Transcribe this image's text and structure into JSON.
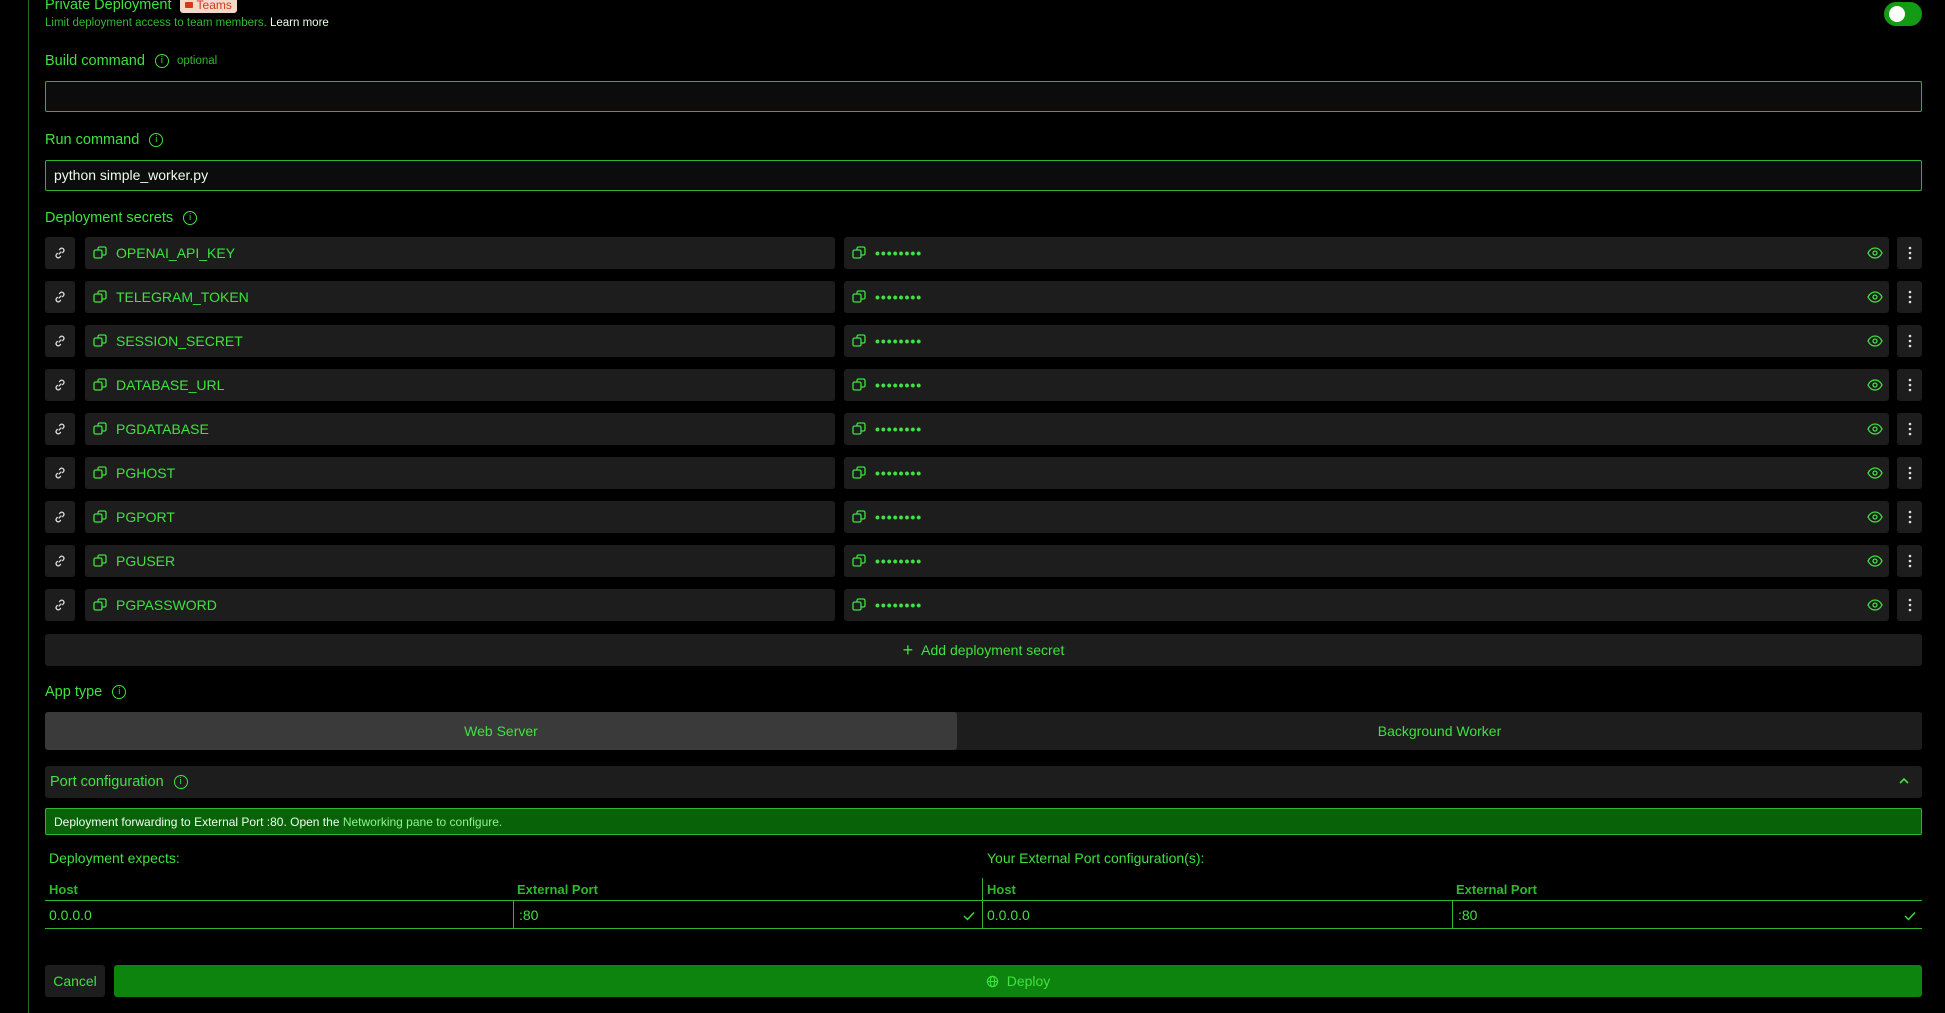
{
  "private_deployment": {
    "title": "Private Deployment",
    "badge": "Teams",
    "description": "Limit deployment access to team members.",
    "learn_more": "Learn more",
    "enabled": true
  },
  "build_command": {
    "label": "Build command",
    "optional": "optional",
    "value": ""
  },
  "run_command": {
    "label": "Run command",
    "value": "python simple_worker.py"
  },
  "secrets": {
    "label": "Deployment secrets",
    "masked": "••••••••",
    "items": [
      {
        "key": "OPENAI_API_KEY"
      },
      {
        "key": "TELEGRAM_TOKEN"
      },
      {
        "key": "SESSION_SECRET"
      },
      {
        "key": "DATABASE_URL"
      },
      {
        "key": "PGDATABASE"
      },
      {
        "key": "PGHOST"
      },
      {
        "key": "PGPORT"
      },
      {
        "key": "PGUSER"
      },
      {
        "key": "PGPASSWORD"
      }
    ],
    "add_label": "Add deployment secret"
  },
  "app_type": {
    "label": "App type",
    "options": [
      "Web Server",
      "Background Worker"
    ],
    "selected": "Web Server"
  },
  "port_config": {
    "label": "Port configuration",
    "notice_prefix": "Deployment forwarding to External Port :80. Open the ",
    "notice_link": "Networking pane to configure.",
    "expects_title": "Deployment expects:",
    "external_title": "Your External Port configuration(s):",
    "col_host": "Host",
    "col_port": "External Port",
    "expects_host": "0.0.0.0",
    "expects_port": ":80",
    "external_host": "0.0.0.0",
    "external_port": ":80"
  },
  "actions": {
    "cancel": "Cancel",
    "deploy": "Deploy"
  },
  "colors": {
    "accent": "#3fe23f",
    "deploy_bg": "#0d840d",
    "notice_bg": "#086308"
  }
}
